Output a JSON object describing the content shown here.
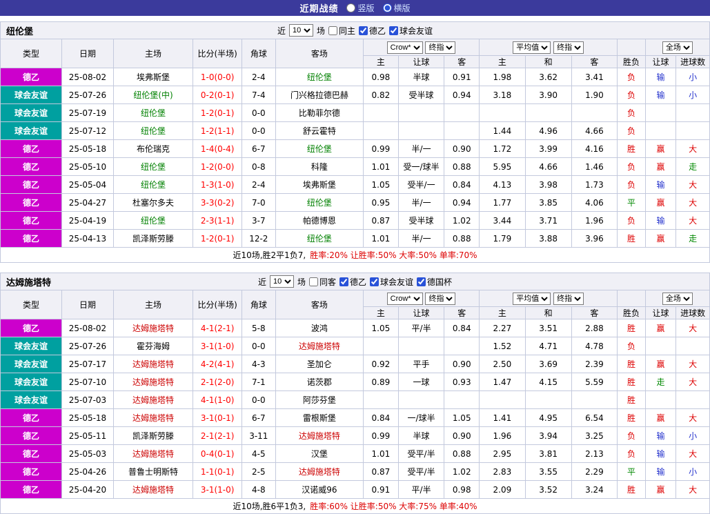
{
  "colors": {
    "bar": "#3b3a9c",
    "border": "#c3c9dd",
    "head_bg": "#f0f0f6",
    "score_red": "#ff0000"
  },
  "type_colors": {
    "德乙": "#cc00cc",
    "球会友谊": "#00a0a0",
    "德国杯": "#996600"
  },
  "value_colors": {
    "胜": "#dd0000",
    "平": "#008800",
    "负": "#dd0000",
    "赢": "#dd0000",
    "输": "#2230cc",
    "走": "#008800",
    "大": "#dd0000",
    "小": "#2230cc"
  },
  "topbar": {
    "title": "近期战绩",
    "radio_vertical": "竖版",
    "radio_horizontal": "横版"
  },
  "controls_labels": {
    "near": "近",
    "games": "场"
  },
  "table_header": {
    "type": "类型",
    "date": "日期",
    "home": "主场",
    "score": "比分(半场)",
    "corner": "角球",
    "away": "客场",
    "odds_company": "Crow*",
    "odds_kind": "终指",
    "avg_label": "平均值",
    "avg_kind": "终指",
    "full_label": "全场",
    "h_home": "主",
    "h_handicap": "让球",
    "h_away": "客",
    "a_home": "主",
    "a_draw": "和",
    "a_away": "客",
    "result": "胜负",
    "r_handicap": "让球",
    "r_goals": "进球数"
  },
  "sections": [
    {
      "team": "纽伦堡",
      "focal_color": "#008000",
      "count": "10",
      "checkboxes": [
        {
          "label": "同主",
          "checked": false
        },
        {
          "label": "德乙",
          "checked": true
        },
        {
          "label": "球会友谊",
          "checked": true
        }
      ],
      "rows": [
        {
          "type": "德乙",
          "date": "25-08-02",
          "home": "埃弗斯堡",
          "focal": "away",
          "score": "1-0(0-0)",
          "corner": "2-4",
          "away": "纽伦堡",
          "o_home": "0.98",
          "handicap": "半球",
          "o_away": "0.91",
          "avg_home": "1.98",
          "avg_draw": "3.62",
          "avg_away": "3.41",
          "result": "负",
          "r_handicap": "输",
          "r_goals": "小"
        },
        {
          "type": "球会友谊",
          "date": "25-07-26",
          "home": "纽伦堡(中)",
          "focal": "home",
          "score": "0-2(0-1)",
          "corner": "7-4",
          "away": "门兴格拉德巴赫",
          "o_home": "0.82",
          "handicap": "受半球",
          "o_away": "0.94",
          "avg_home": "3.18",
          "avg_draw": "3.90",
          "avg_away": "1.90",
          "result": "负",
          "r_handicap": "输",
          "r_goals": "小"
        },
        {
          "type": "球会友谊",
          "date": "25-07-19",
          "home": "纽伦堡",
          "focal": "home",
          "score": "1-2(0-1)",
          "corner": "0-0",
          "away": "比勒菲尔德",
          "o_home": "",
          "handicap": "",
          "o_away": "",
          "avg_home": "",
          "avg_draw": "",
          "avg_away": "",
          "result": "负",
          "r_handicap": "",
          "r_goals": ""
        },
        {
          "type": "球会友谊",
          "date": "25-07-12",
          "home": "纽伦堡",
          "focal": "home",
          "score": "1-2(1-1)",
          "corner": "0-0",
          "away": "舒云霍特",
          "o_home": "",
          "handicap": "",
          "o_away": "",
          "avg_home": "1.44",
          "avg_draw": "4.96",
          "avg_away": "4.66",
          "result": "负",
          "r_handicap": "",
          "r_goals": ""
        },
        {
          "type": "德乙",
          "date": "25-05-18",
          "home": "布伦瑞克",
          "focal": "away",
          "score": "1-4(0-4)",
          "corner": "6-7",
          "away": "纽伦堡",
          "o_home": "0.99",
          "handicap": "半/一",
          "o_away": "0.90",
          "avg_home": "1.72",
          "avg_draw": "3.99",
          "avg_away": "4.16",
          "result": "胜",
          "r_handicap": "赢",
          "r_goals": "大"
        },
        {
          "type": "德乙",
          "date": "25-05-10",
          "home": "纽伦堡",
          "focal": "home",
          "score": "1-2(0-0)",
          "corner": "0-8",
          "away": "科隆",
          "o_home": "1.01",
          "handicap": "受一/球半",
          "o_away": "0.88",
          "avg_home": "5.95",
          "avg_draw": "4.66",
          "avg_away": "1.46",
          "result": "负",
          "r_handicap": "赢",
          "r_goals": "走"
        },
        {
          "type": "德乙",
          "date": "25-05-04",
          "home": "纽伦堡",
          "focal": "home",
          "score": "1-3(1-0)",
          "corner": "2-4",
          "away": "埃弗斯堡",
          "o_home": "1.05",
          "handicap": "受半/一",
          "o_away": "0.84",
          "avg_home": "4.13",
          "avg_draw": "3.98",
          "avg_away": "1.73",
          "result": "负",
          "r_handicap": "输",
          "r_goals": "大"
        },
        {
          "type": "德乙",
          "date": "25-04-27",
          "home": "杜塞尔多夫",
          "focal": "away",
          "score": "3-3(0-2)",
          "corner": "7-0",
          "away": "纽伦堡",
          "o_home": "0.95",
          "handicap": "半/一",
          "o_away": "0.94",
          "avg_home": "1.77",
          "avg_draw": "3.85",
          "avg_away": "4.06",
          "result": "平",
          "r_handicap": "赢",
          "r_goals": "大"
        },
        {
          "type": "德乙",
          "date": "25-04-19",
          "home": "纽伦堡",
          "focal": "home",
          "score": "2-3(1-1)",
          "corner": "3-7",
          "away": "帕德博恩",
          "o_home": "0.87",
          "handicap": "受半球",
          "o_away": "1.02",
          "avg_home": "3.44",
          "avg_draw": "3.71",
          "avg_away": "1.96",
          "result": "负",
          "r_handicap": "输",
          "r_goals": "大"
        },
        {
          "type": "德乙",
          "date": "25-04-13",
          "home": "凯泽斯劳滕",
          "focal": "away",
          "score": "1-2(0-1)",
          "corner": "12-2",
          "away": "纽伦堡",
          "o_home": "1.01",
          "handicap": "半/一",
          "o_away": "0.88",
          "avg_home": "1.79",
          "avg_draw": "3.88",
          "avg_away": "3.96",
          "result": "胜",
          "r_handicap": "赢",
          "r_goals": "走"
        }
      ],
      "summary": {
        "prefix": "近10场,胜2平1负7,",
        "stats": "胜率:20% 让胜率:50% 大率:50% 单率:70%"
      }
    },
    {
      "team": "达姆施塔特",
      "focal_color": "#cc0000",
      "count": "10",
      "checkboxes": [
        {
          "label": "同客",
          "checked": false
        },
        {
          "label": "德乙",
          "checked": true
        },
        {
          "label": "球会友谊",
          "checked": true
        },
        {
          "label": "德国杯",
          "checked": true
        }
      ],
      "rows": [
        {
          "type": "德乙",
          "date": "25-08-02",
          "home": "达姆施塔特",
          "focal": "home",
          "score": "4-1(2-1)",
          "corner": "5-8",
          "away": "波鸿",
          "o_home": "1.05",
          "handicap": "平/半",
          "o_away": "0.84",
          "avg_home": "2.27",
          "avg_draw": "3.51",
          "avg_away": "2.88",
          "result": "胜",
          "r_handicap": "赢",
          "r_goals": "大"
        },
        {
          "type": "球会友谊",
          "date": "25-07-26",
          "home": "霍芬海姆",
          "focal": "away",
          "score": "3-1(1-0)",
          "corner": "0-0",
          "away": "达姆施塔特",
          "o_home": "",
          "handicap": "",
          "o_away": "",
          "avg_home": "1.52",
          "avg_draw": "4.71",
          "avg_away": "4.78",
          "result": "负",
          "r_handicap": "",
          "r_goals": ""
        },
        {
          "type": "球会友谊",
          "date": "25-07-17",
          "home": "达姆施塔特",
          "focal": "home",
          "score": "4-2(4-1)",
          "corner": "4-3",
          "away": "圣加仑",
          "o_home": "0.92",
          "handicap": "平手",
          "o_away": "0.90",
          "avg_home": "2.50",
          "avg_draw": "3.69",
          "avg_away": "2.39",
          "result": "胜",
          "r_handicap": "赢",
          "r_goals": "大"
        },
        {
          "type": "球会友谊",
          "date": "25-07-10",
          "home": "达姆施塔特",
          "focal": "home",
          "score": "2-1(2-0)",
          "corner": "7-1",
          "away": "诺茨郡",
          "o_home": "0.89",
          "handicap": "一球",
          "o_away": "0.93",
          "avg_home": "1.47",
          "avg_draw": "4.15",
          "avg_away": "5.59",
          "result": "胜",
          "r_handicap": "走",
          "r_goals": "大"
        },
        {
          "type": "球会友谊",
          "date": "25-07-03",
          "home": "达姆施塔特",
          "focal": "home",
          "score": "4-1(1-0)",
          "corner": "0-0",
          "away": "阿莎芬堡",
          "o_home": "",
          "handicap": "",
          "o_away": "",
          "avg_home": "",
          "avg_draw": "",
          "avg_away": "",
          "result": "胜",
          "r_handicap": "",
          "r_goals": ""
        },
        {
          "type": "德乙",
          "date": "25-05-18",
          "home": "达姆施塔特",
          "focal": "home",
          "score": "3-1(0-1)",
          "corner": "6-7",
          "away": "雷根斯堡",
          "o_home": "0.84",
          "handicap": "一/球半",
          "o_away": "1.05",
          "avg_home": "1.41",
          "avg_draw": "4.95",
          "avg_away": "6.54",
          "result": "胜",
          "r_handicap": "赢",
          "r_goals": "大"
        },
        {
          "type": "德乙",
          "date": "25-05-11",
          "home": "凯泽斯劳滕",
          "focal": "away",
          "score": "2-1(2-1)",
          "corner": "3-11",
          "away": "达姆施塔特",
          "o_home": "0.99",
          "handicap": "半球",
          "o_away": "0.90",
          "avg_home": "1.96",
          "avg_draw": "3.94",
          "avg_away": "3.25",
          "result": "负",
          "r_handicap": "输",
          "r_goals": "小"
        },
        {
          "type": "德乙",
          "date": "25-05-03",
          "home": "达姆施塔特",
          "focal": "home",
          "score": "0-4(0-1)",
          "corner": "4-5",
          "away": "汉堡",
          "o_home": "1.01",
          "handicap": "受平/半",
          "o_away": "0.88",
          "avg_home": "2.95",
          "avg_draw": "3.81",
          "avg_away": "2.13",
          "result": "负",
          "r_handicap": "输",
          "r_goals": "大"
        },
        {
          "type": "德乙",
          "date": "25-04-26",
          "home": "普鲁士明斯特",
          "focal": "away",
          "score": "1-1(0-1)",
          "corner": "2-5",
          "away": "达姆施塔特",
          "o_home": "0.87",
          "handicap": "受平/半",
          "o_away": "1.02",
          "avg_home": "2.83",
          "avg_draw": "3.55",
          "avg_away": "2.29",
          "result": "平",
          "r_handicap": "输",
          "r_goals": "小"
        },
        {
          "type": "德乙",
          "date": "25-04-20",
          "home": "达姆施塔特",
          "focal": "home",
          "score": "3-1(1-0)",
          "corner": "4-8",
          "away": "汉诺威96",
          "o_home": "0.91",
          "handicap": "平/半",
          "o_away": "0.98",
          "avg_home": "2.09",
          "avg_draw": "3.52",
          "avg_away": "3.24",
          "result": "胜",
          "r_handicap": "赢",
          "r_goals": "大"
        }
      ],
      "summary": {
        "prefix": "近10场,胜6平1负3,",
        "stats": "胜率:60% 让胜率:50% 大率:75% 单率:40%"
      }
    }
  ]
}
